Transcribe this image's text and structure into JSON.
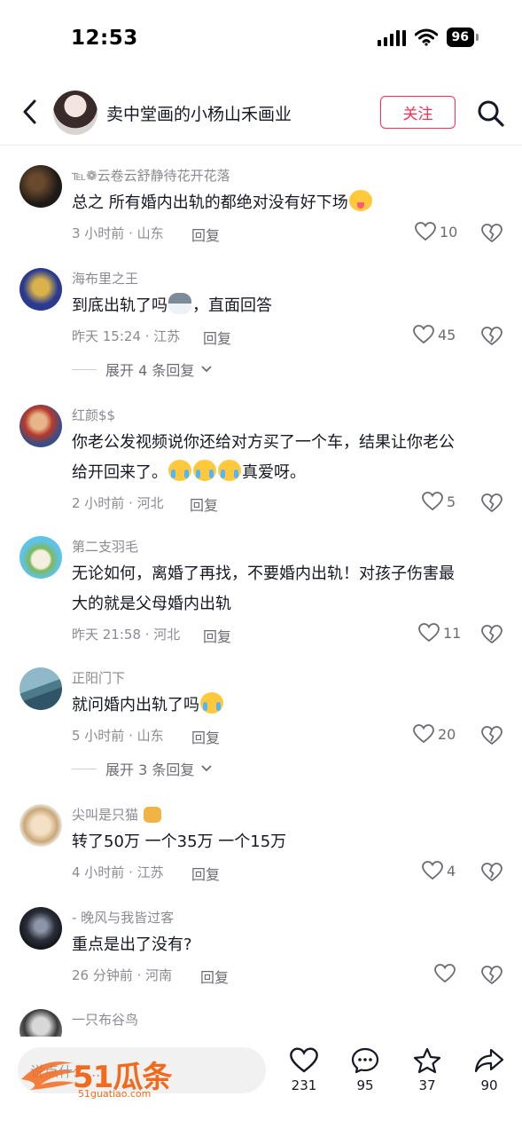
{
  "status_bar": {
    "time": "12:53",
    "battery": "96"
  },
  "header": {
    "title": "卖中堂画的小杨山禾画业",
    "follow_label": "关注"
  },
  "comments": [
    {
      "username": "℡❁云卷云舒静待花开花落",
      "text": "总之 所有婚内出轨的都绝对没有好下场",
      "emojis": [
        "tongue-face"
      ],
      "time_location": "3 小时前 · 山东",
      "reply_label": "回复",
      "likes": "10"
    },
    {
      "username": "海布里之王",
      "text_before": "到底出轨了吗",
      "text_after": "，直面回答",
      "emojis": [
        "husky"
      ],
      "time_location": "昨天 15:24 · 江苏",
      "reply_label": "回复",
      "likes": "45",
      "expand_label": "展开 4 条回复"
    },
    {
      "username": "红颜$$",
      "text_line1": "你老公发视频说你还给对方买了一个车，结果让你老公",
      "text_line2": "给开回来了。",
      "text_after": "真爱呀。",
      "emojis": [
        "cry",
        "cry",
        "cry"
      ],
      "time_location": "2 小时前 · 河北",
      "reply_label": "回复",
      "likes": "5"
    },
    {
      "username": "第二支羽毛",
      "text_line1": "无论如何，离婚了再找，不要婚内出轨！对孩子伤害最",
      "text_line2": "大的就是父母婚内出轨",
      "time_location": "昨天 21:58 · 河北",
      "reply_label": "回复",
      "likes": "11"
    },
    {
      "username": "正阳门下",
      "text": "就问婚内出轨了吗",
      "emojis": [
        "cry"
      ],
      "time_location": "5 小时前 · 山东",
      "reply_label": "回复",
      "likes": "20",
      "expand_label": "展开 3 条回复"
    },
    {
      "username": "尖叫是只猫",
      "text": "转了50万 一个35万 一个15万",
      "emojis": [
        "cat"
      ],
      "time_location": "4 小时前 · 江苏",
      "reply_label": "回复",
      "likes": "4"
    },
    {
      "username": "- 晚风与我皆过客",
      "text": "重点是出了没有?",
      "time_location": "26 分钟前 · 河南",
      "reply_label": "回复",
      "likes": ""
    },
    {
      "username": "一只布谷鸟"
    }
  ],
  "bottom_bar": {
    "input_placeholder": "说点什么...",
    "watermark": "51瓜条",
    "watermark_url": "51guatiao.com",
    "actions": [
      {
        "icon": "heart-icon",
        "count": "231"
      },
      {
        "icon": "comment-icon",
        "count": "95"
      },
      {
        "icon": "star-icon",
        "count": "37"
      },
      {
        "icon": "share-icon",
        "count": "90"
      }
    ]
  },
  "colors": {
    "accent": "#fe2c55",
    "text": "#161823",
    "secondary": "#8a8b91",
    "watermark": "#f26b1d"
  }
}
